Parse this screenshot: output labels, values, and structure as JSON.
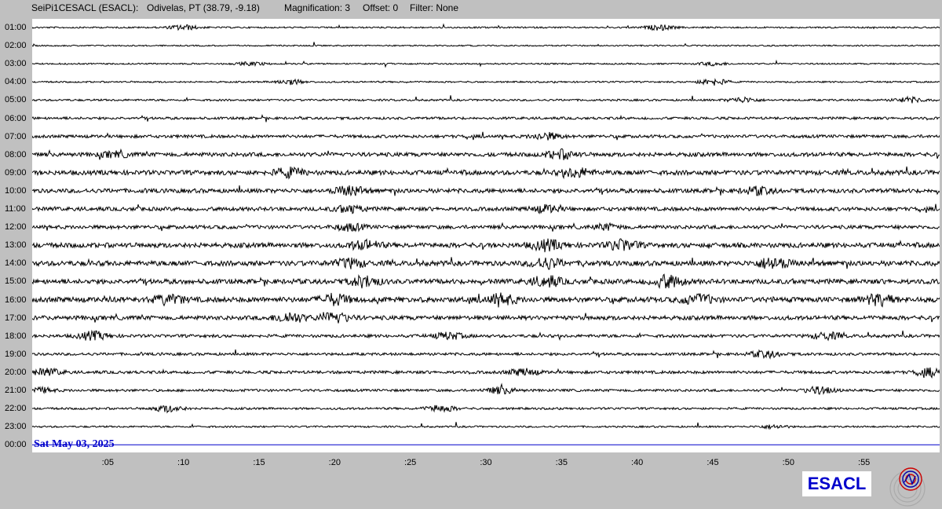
{
  "header": {
    "station": "SeiPi1CESACL (ESACL):",
    "location": "Odivelas, PT (38.79, -9.18)",
    "magnification": "Magnification: 3",
    "offset": "Offset: 0",
    "filter": "Filter: None"
  },
  "date_label": "Sat May 03, 2025",
  "logo_text": "ESACL",
  "colors": {
    "background": "#c0c0c0",
    "plot": "#ffffff",
    "trace": "#000000",
    "current_hour_line": "#0000cc",
    "date_text": "#0000cc"
  },
  "chart_data": {
    "type": "line",
    "title": "",
    "xlabel": "",
    "ylabel": "",
    "x_tick_labels": [
      ":05",
      ":10",
      ":15",
      ":20",
      ":25",
      ":30",
      ":35",
      ":40",
      ":45",
      ":50",
      ":55"
    ],
    "x_ticks_minutes": [
      5,
      10,
      15,
      20,
      25,
      30,
      35,
      40,
      45,
      50,
      55
    ],
    "xlim_minutes": [
      0,
      60
    ],
    "hour_labels": [
      "01:00",
      "02:00",
      "03:00",
      "04:00",
      "05:00",
      "06:00",
      "07:00",
      "08:00",
      "09:00",
      "10:00",
      "11:00",
      "12:00",
      "13:00",
      "14:00",
      "15:00",
      "16:00",
      "17:00",
      "18:00",
      "19:00",
      "20:00",
      "21:00",
      "22:00",
      "23:00",
      "00:00"
    ],
    "noise_level": [
      0.3,
      0.2,
      0.25,
      0.3,
      0.5,
      0.8,
      1.1,
      1.6,
      1.9,
      1.7,
      1.5,
      1.4,
      2.0,
      2.1,
      2.0,
      2.2,
      1.7,
      1.1,
      0.9,
      1.0,
      0.8,
      0.6,
      0.4,
      0
    ],
    "events": [
      {
        "row": 0,
        "minute": 10,
        "amp": 3
      },
      {
        "row": 0,
        "minute": 41.5,
        "amp": 3
      },
      {
        "row": 2,
        "minute": 14.5,
        "amp": 2
      },
      {
        "row": 2,
        "minute": 45,
        "amp": 2
      },
      {
        "row": 3,
        "minute": 17,
        "amp": 3
      },
      {
        "row": 3,
        "minute": 45,
        "amp": 4
      },
      {
        "row": 4,
        "minute": 47,
        "amp": 3
      },
      {
        "row": 4,
        "minute": 58,
        "amp": 3
      },
      {
        "row": 6,
        "minute": 34,
        "amp": 4
      },
      {
        "row": 7,
        "minute": 5.5,
        "amp": 3
      },
      {
        "row": 7,
        "minute": 35,
        "amp": 5
      },
      {
        "row": 8,
        "minute": 17,
        "amp": 5
      },
      {
        "row": 8,
        "minute": 36,
        "amp": 5
      },
      {
        "row": 9,
        "minute": 21,
        "amp": 5
      },
      {
        "row": 9,
        "minute": 48,
        "amp": 4
      },
      {
        "row": 10,
        "minute": 21,
        "amp": 4
      },
      {
        "row": 10,
        "minute": 34,
        "amp": 4
      },
      {
        "row": 11,
        "minute": 21,
        "amp": 4
      },
      {
        "row": 11,
        "minute": 38,
        "amp": 3
      },
      {
        "row": 12,
        "minute": 22,
        "amp": 5
      },
      {
        "row": 12,
        "minute": 34,
        "amp": 6
      },
      {
        "row": 12,
        "minute": 39,
        "amp": 6
      },
      {
        "row": 13,
        "minute": 21,
        "amp": 5
      },
      {
        "row": 13,
        "minute": 34,
        "amp": 6
      },
      {
        "row": 13,
        "minute": 49,
        "amp": 7
      },
      {
        "row": 14,
        "minute": 22,
        "amp": 6
      },
      {
        "row": 14,
        "minute": 34,
        "amp": 6
      },
      {
        "row": 14,
        "minute": 42,
        "amp": 7
      },
      {
        "row": 15,
        "minute": 9,
        "amp": 5
      },
      {
        "row": 15,
        "minute": 20,
        "amp": 6
      },
      {
        "row": 15,
        "minute": 31,
        "amp": 6
      },
      {
        "row": 15,
        "minute": 44,
        "amp": 6
      },
      {
        "row": 15,
        "minute": 56,
        "amp": 6
      },
      {
        "row": 16,
        "minute": 17,
        "amp": 6
      },
      {
        "row": 16,
        "minute": 20,
        "amp": 6
      },
      {
        "row": 17,
        "minute": 4,
        "amp": 5
      },
      {
        "row": 17,
        "minute": 27.5,
        "amp": 4
      },
      {
        "row": 17,
        "minute": 52.5,
        "amp": 4
      },
      {
        "row": 18,
        "minute": 48.5,
        "amp": 4
      },
      {
        "row": 19,
        "minute": 1,
        "amp": 4
      },
      {
        "row": 19,
        "minute": 32.5,
        "amp": 4
      },
      {
        "row": 19,
        "minute": 59.5,
        "amp": 5
      },
      {
        "row": 20,
        "minute": 0.5,
        "amp": 3
      },
      {
        "row": 20,
        "minute": 31,
        "amp": 4
      },
      {
        "row": 20,
        "minute": 52,
        "amp": 4
      },
      {
        "row": 21,
        "minute": 9,
        "amp": 4
      },
      {
        "row": 21,
        "minute": 27,
        "amp": 4
      },
      {
        "row": 22,
        "minute": 49,
        "amp": 2
      }
    ]
  }
}
